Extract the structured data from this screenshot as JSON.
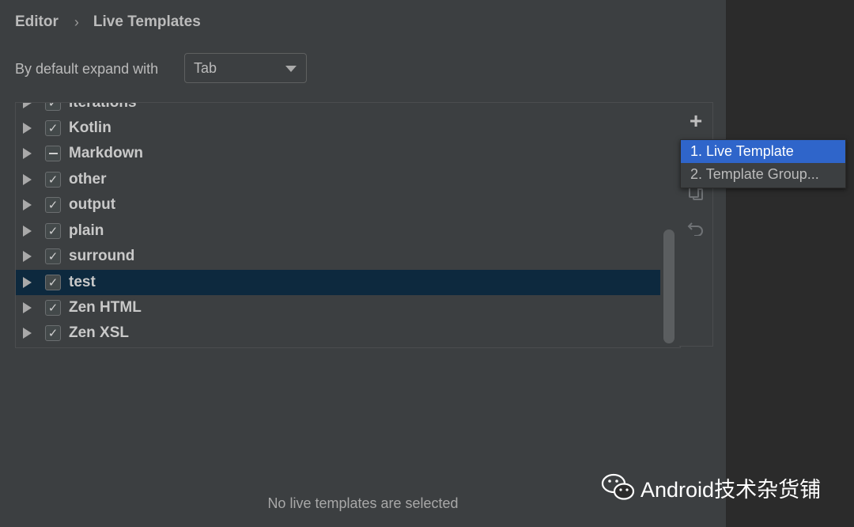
{
  "breadcrumb": {
    "parent": "Editor",
    "current": "Live Templates"
  },
  "expand": {
    "label": "By default expand with",
    "value": "Tab"
  },
  "groups": [
    {
      "label": "iterations",
      "state": "checked"
    },
    {
      "label": "Kotlin",
      "state": "checked"
    },
    {
      "label": "Markdown",
      "state": "partial"
    },
    {
      "label": "other",
      "state": "checked"
    },
    {
      "label": "output",
      "state": "checked"
    },
    {
      "label": "plain",
      "state": "checked"
    },
    {
      "label": "surround",
      "state": "checked"
    },
    {
      "label": "test",
      "state": "checked",
      "selected": true
    },
    {
      "label": "Zen HTML",
      "state": "checked"
    },
    {
      "label": "Zen XSL",
      "state": "checked"
    }
  ],
  "toolbar": {
    "add_icon": "plus-icon",
    "copy_icon": "copy-icon",
    "restore_icon": "undo-icon"
  },
  "add_menu": {
    "items": [
      "1. Live Template",
      "2. Template Group..."
    ],
    "active_index": 0
  },
  "status": {
    "empty_message": "No live templates are selected"
  },
  "watermark": {
    "text": "Android技术杂货铺"
  },
  "colors": {
    "selection": "#0d293e",
    "menu_highlight": "#2f65ca",
    "panel": "#3c3f41",
    "background": "#2b2b2b"
  }
}
